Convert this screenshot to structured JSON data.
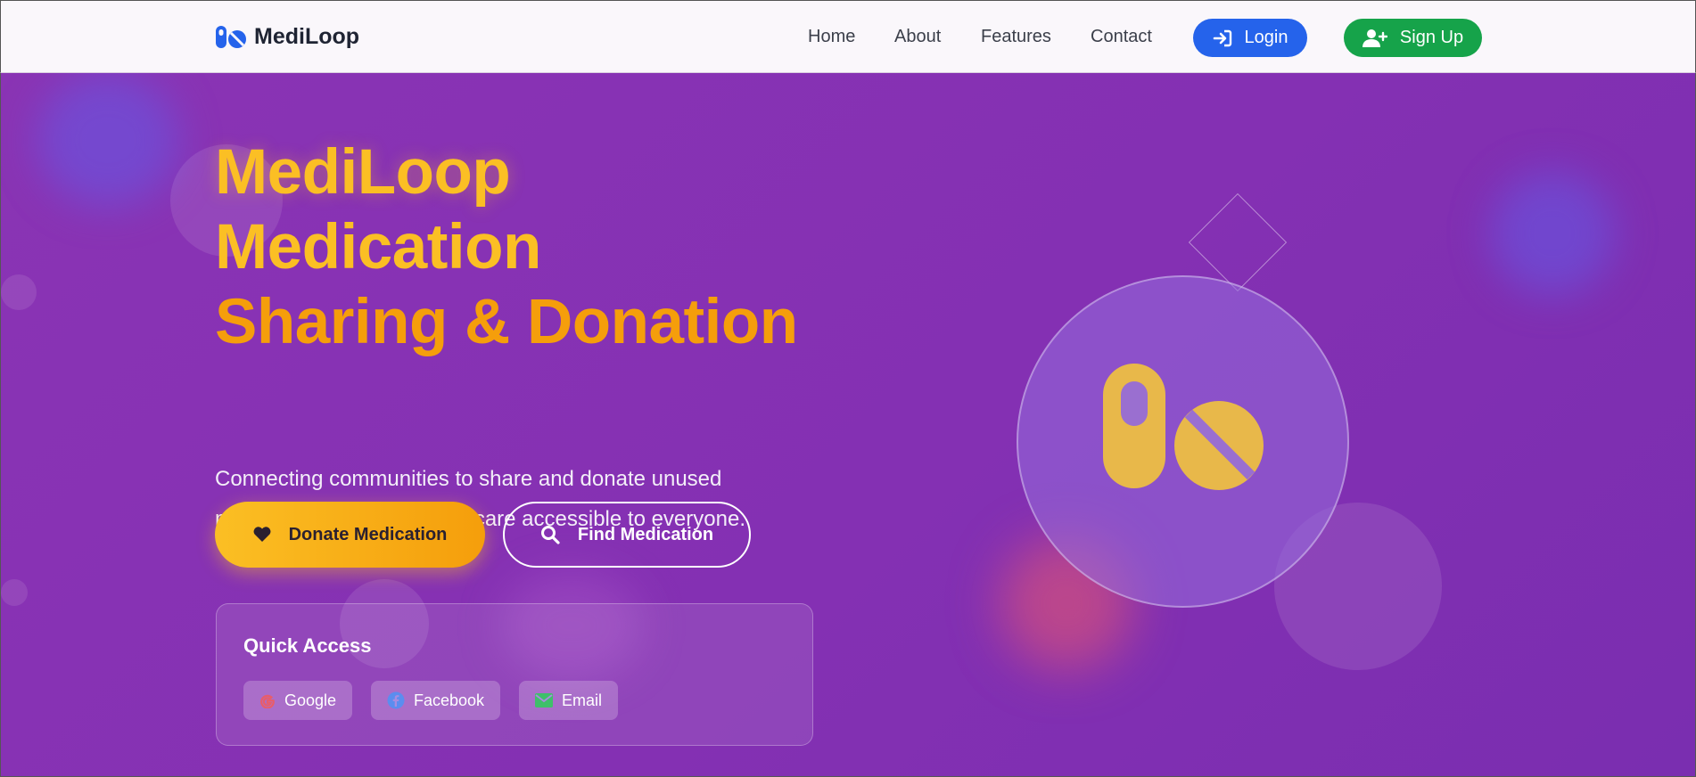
{
  "brand": {
    "name": "MediLoop",
    "icon": "pills-icon"
  },
  "nav": {
    "links": [
      "Home",
      "About",
      "Features",
      "Contact"
    ],
    "login_label": "Login",
    "signup_label": "Sign Up"
  },
  "hero": {
    "title_line1": "MediLoop",
    "title_line2": "Medication",
    "title_line3": "Sharing & Donation",
    "subtitle": "Connecting communities to share and donate unused medications, making healthcare accessible to everyone.",
    "donate_label": "Donate Medication",
    "find_label": "Find Medication"
  },
  "quick_access": {
    "title": "Quick Access",
    "items": [
      "Google",
      "Facebook",
      "Email"
    ]
  },
  "colors": {
    "brand_blue": "#2563eb",
    "signup_green": "#16a34a",
    "accent_yellow": "#fbbf24",
    "accent_orange": "#f59e0b",
    "hero_purple": "#8430b3"
  }
}
